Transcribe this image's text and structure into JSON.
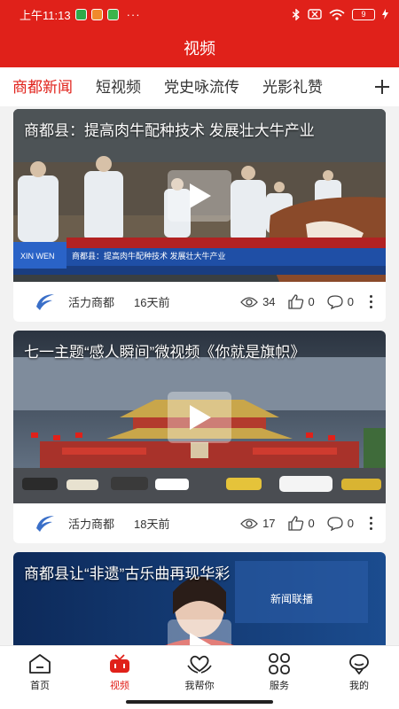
{
  "status_bar": {
    "time": "上午11:13",
    "more": "···",
    "battery": "9"
  },
  "header": {
    "title": "视频"
  },
  "tabs": {
    "items": [
      {
        "label": "商都新闻",
        "active": true
      },
      {
        "label": "短视频",
        "active": false
      },
      {
        "label": "党史咏流传",
        "active": false
      },
      {
        "label": "光影礼赞",
        "active": false
      }
    ],
    "add_icon": "plus-icon"
  },
  "feed": {
    "cards": [
      {
        "title": "商都县：提高肉牛配种技术 发展壮大牛产业",
        "banner_text": "商都县：提高肉牛配种技术 发展壮大牛产业",
        "source": "活力商都",
        "time": "16天前",
        "views": "34",
        "likes": "0",
        "comments": "0"
      },
      {
        "title": "七一主题“感人瞬间”微视频《你就是旗帜》",
        "source": "活力商都",
        "time": "18天前",
        "views": "17",
        "likes": "0",
        "comments": "0"
      },
      {
        "title": "商都县让“非遗”古乐曲再现华彩",
        "overlay_text": "新闻联播"
      }
    ]
  },
  "bottom_nav": {
    "items": [
      {
        "label": "首页",
        "icon": "home-icon",
        "active": false
      },
      {
        "label": "视频",
        "icon": "tv-icon",
        "active": true
      },
      {
        "label": "我帮你",
        "icon": "heart-hands-icon",
        "active": false
      },
      {
        "label": "服务",
        "icon": "grid-icon",
        "active": false
      },
      {
        "label": "我的",
        "icon": "profile-icon",
        "active": false
      }
    ]
  },
  "colors": {
    "brand": "#e0211a",
    "background": "#f2f2f2"
  }
}
